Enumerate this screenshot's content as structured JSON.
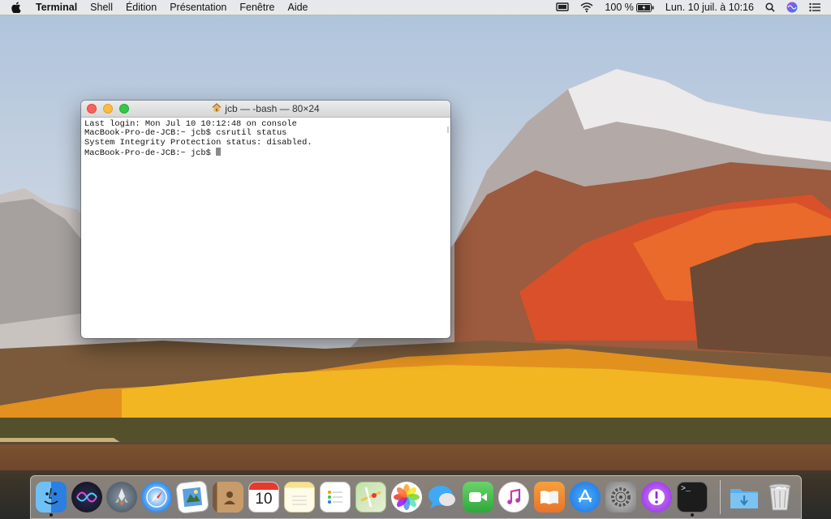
{
  "menubar": {
    "apple_icon": "apple-logo-icon",
    "app_name": "Terminal",
    "items": [
      "Shell",
      "Édition",
      "Présentation",
      "Fenêtre",
      "Aide"
    ],
    "battery_percent": "100 %",
    "datetime": "Lun. 10 juil. à 10:16"
  },
  "terminal": {
    "title": "jcb — -bash — 80×24",
    "lines": [
      "Last login: Mon Jul 10 10:12:48 on console",
      "MacBook-Pro-de-JCB:~ jcb$ csrutil status",
      "System Integrity Protection status: disabled.",
      "MacBook-Pro-de-JCB:~ jcb$ "
    ]
  },
  "dock": {
    "calendar_day": "10",
    "terminal_prompt": ">_",
    "apps": [
      "Finder",
      "Siri",
      "Launchpad",
      "Safari",
      "Aperçu",
      "Contacts",
      "Calendrier",
      "Notes",
      "Rappels",
      "Plans",
      "Photos",
      "Messages",
      "FaceTime",
      "iTunes",
      "iBooks",
      "App Store",
      "Préférences Système",
      "Feedback Assistant",
      "Terminal",
      "Téléchargements",
      "Corbeille"
    ]
  },
  "colors": {
    "accent": "#1b7ef5",
    "close": "#fc605c",
    "minimize": "#fdbc40",
    "maximize": "#34c84a"
  }
}
